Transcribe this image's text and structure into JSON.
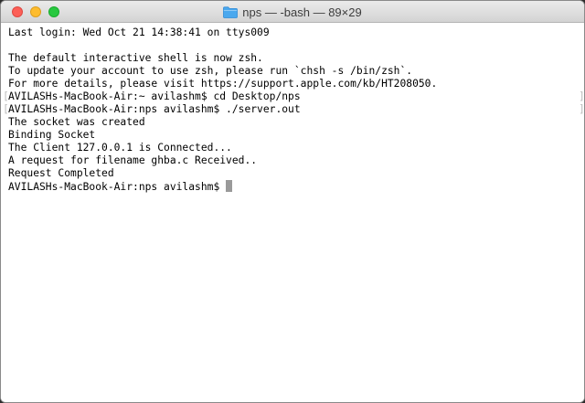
{
  "window": {
    "title": "nps — -bash — 89×29"
  },
  "terminal": {
    "lines": [
      "Last login: Wed Oct 21 14:38:41 on ttys009",
      "",
      "The default interactive shell is now zsh.",
      "To update your account to use zsh, please run `chsh -s /bin/zsh`.",
      "For more details, please visit https://support.apple.com/kb/HT208050.",
      "AVILASHs-MacBook-Air:~ avilashm$ cd Desktop/nps",
      "AVILASHs-MacBook-Air:nps avilashm$ ./server.out",
      "The socket was created",
      "Binding Socket",
      "The Client 127.0.0.1 is Connected...",
      "A request for filename ghba.c Received..",
      "Request Completed",
      "AVILASHs-MacBook-Air:nps avilashm$ "
    ],
    "marked_lines": [
      5,
      6
    ],
    "cursor_line": 12
  },
  "colors": {
    "close": "#fc5f57",
    "minimize": "#fdbc2e",
    "maximize": "#28c840",
    "folder": "#4aa8ee"
  },
  "icons": {
    "title_icon": "folder-icon"
  }
}
